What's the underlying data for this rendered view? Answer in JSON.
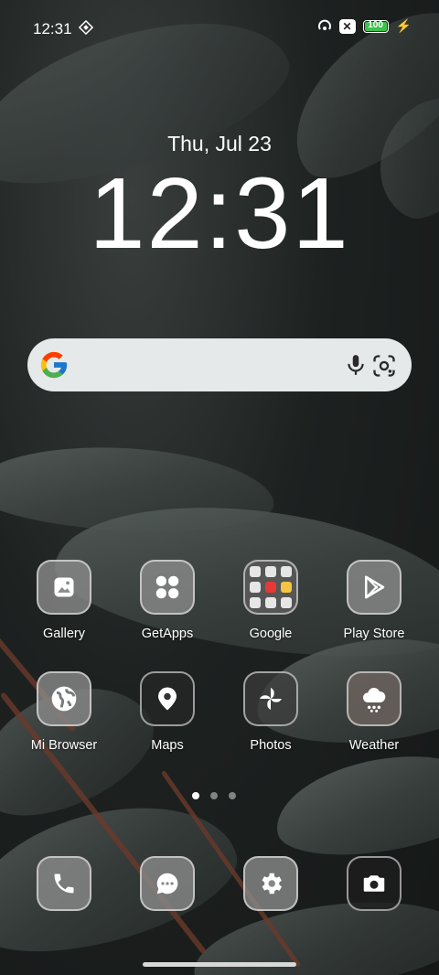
{
  "status_bar": {
    "time": "12:31",
    "battery_label": "100",
    "battery_level": 100,
    "battery_color": "#3fc14b"
  },
  "lock": {
    "date": "Thu, Jul 23",
    "time": "12:31"
  },
  "search": {
    "google_icon": "google-logo",
    "mic_icon": "microphone-icon",
    "lens_icon": "google-lens-icon"
  },
  "apps": [
    {
      "label": "Gallery",
      "icon": "gallery-icon"
    },
    {
      "label": "GetApps",
      "icon": "getapps-icon"
    },
    {
      "label": "Google",
      "icon": "folder-icon"
    },
    {
      "label": "Play Store",
      "icon": "play-store-icon"
    },
    {
      "label": "Mi Browser",
      "icon": "globe-icon"
    },
    {
      "label": "Maps",
      "icon": "map-pin-icon"
    },
    {
      "label": "Photos",
      "icon": "pinwheel-icon"
    },
    {
      "label": "Weather",
      "icon": "cloud-rain-icon"
    }
  ],
  "dock": [
    {
      "icon": "phone-icon"
    },
    {
      "icon": "messages-icon"
    },
    {
      "icon": "settings-gear-icon"
    },
    {
      "icon": "camera-icon"
    }
  ],
  "pagination": {
    "pages": 3,
    "current": 1
  }
}
